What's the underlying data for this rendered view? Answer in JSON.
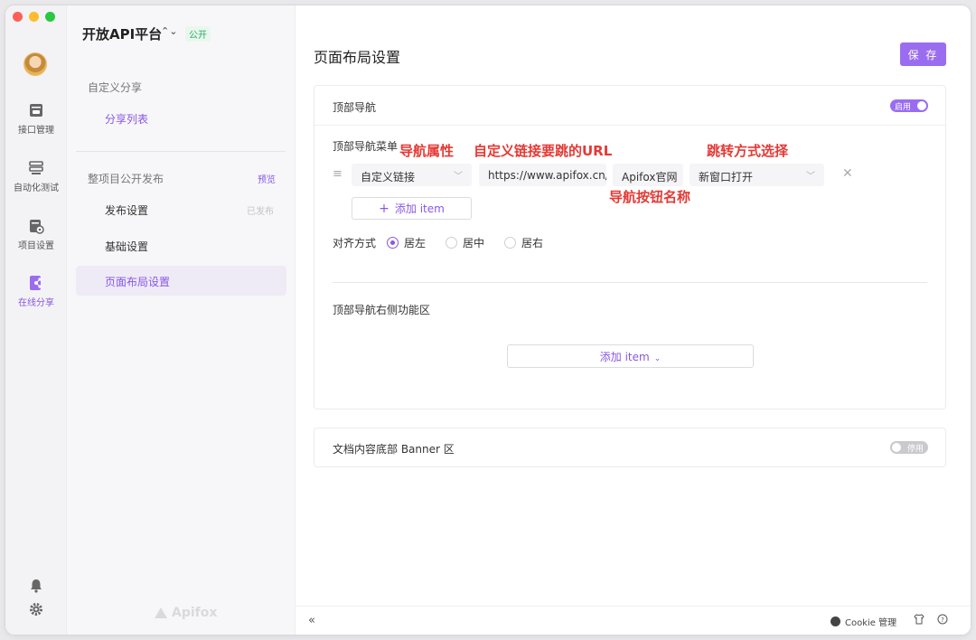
{
  "sidebar": {
    "items": [
      {
        "label": "接口管理",
        "icon": "api-management-icon"
      },
      {
        "label": "自动化测试",
        "icon": "automation-test-icon"
      },
      {
        "label": "项目设置",
        "icon": "project-settings-icon"
      },
      {
        "label": "在线分享",
        "icon": "online-share-icon"
      }
    ]
  },
  "nav": {
    "project_title": "开放API平台",
    "public_tag": "公开",
    "section_custom_share": "自定义分享",
    "share_list": "分享列表",
    "section_publish": "整项目公开发布",
    "preview_label": "预览",
    "publish_settings": "发布设置",
    "published_badge": "已发布",
    "basic_settings": "基础设置",
    "page_layout_settings": "页面布局设置",
    "logo_text": "Apifox"
  },
  "main": {
    "page_title": "页面布局设置",
    "save_label": "保 存",
    "top_nav": {
      "title": "顶部导航",
      "toggle_label": "启用",
      "menu_label": "顶部导航菜单",
      "item_type": "自定义链接",
      "item_url": "https://www.apifox.cn/",
      "item_name": "Apifox官网",
      "item_open_mode": "新窗口打开",
      "add_item_label": "添加 item",
      "align_label": "对齐方式",
      "align_options": [
        "居左",
        "居中",
        "居右"
      ],
      "right_area_title": "顶部导航右侧功能区",
      "right_add_item_label": "添加 item"
    },
    "banner": {
      "title": "文档内容底部 Banner 区",
      "toggle_label": "停用"
    }
  },
  "annotations": {
    "nav_attr": "导航属性",
    "custom_link": "自定义链接要跳的URL",
    "jump_mode": "跳转方式选择",
    "nav_button_name": "导航按钮名称"
  },
  "bottombar": {
    "cookie_label": "Cookie 管理"
  }
}
